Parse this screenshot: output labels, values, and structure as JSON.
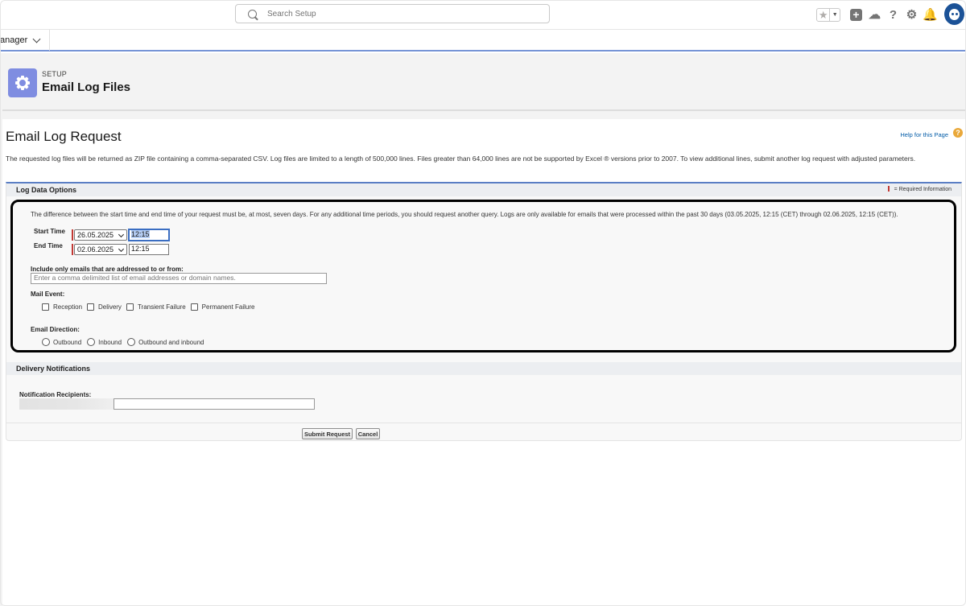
{
  "header": {
    "search_placeholder": "Search Setup",
    "icons": [
      "star-icon",
      "chevron-down-icon",
      "add-icon",
      "trailhead-icon",
      "help-icon",
      "gear-icon",
      "bell-icon",
      "avatar"
    ]
  },
  "nav": {
    "app_name": "anager"
  },
  "setup": {
    "label": "SETUP",
    "title": "Email Log Files"
  },
  "page": {
    "heading": "Email Log Request",
    "help_link": "Help for this Page",
    "intro": "The requested log files will be returned as ZIP file containing a comma-separated CSV. Log files are limited to a length of 500,000 lines. Files greater than 64,000 lines are not be supported by Excel ® versions prior to 2007. To view additional lines, submit another log request with adjusted parameters."
  },
  "log_options": {
    "section_title": "Log Data Options",
    "required_note": "= Required Information",
    "info": "The difference between the start time and end time of your request must be, at most, seven days. For any additional time periods, you should request another query. Logs are only available for emails that were processed within the past 30 days (03.05.2025, 12:15 (CET) through 02.06.2025, 12:15 (CET)).",
    "start_time_label": "Start Time",
    "start_date": "26.05.2025",
    "start_time": "12:15",
    "end_time_label": "End Time",
    "end_date": "02.06.2025",
    "end_time": "12:15",
    "include_label": "Include only emails that are addressed to or from:",
    "include_placeholder": "Enter a comma delimited list of email addresses or domain names.",
    "mail_event_label": "Mail Event:",
    "mail_events": [
      "Reception",
      "Delivery",
      "Transient Failure",
      "Permanent Failure"
    ],
    "direction_label": "Email Direction:",
    "directions": [
      "Outbound",
      "Inbound",
      "Outbound and inbound"
    ]
  },
  "delivery": {
    "section_title": "Delivery Notifications",
    "recipients_label": "Notification Recipients:"
  },
  "buttons": {
    "submit": "Submit Request",
    "cancel": "Cancel"
  },
  "colors": {
    "accent": "#5a7ec4",
    "setup_icon": "#7f8de1",
    "required": "#c23934",
    "help": "#e9a83a"
  }
}
